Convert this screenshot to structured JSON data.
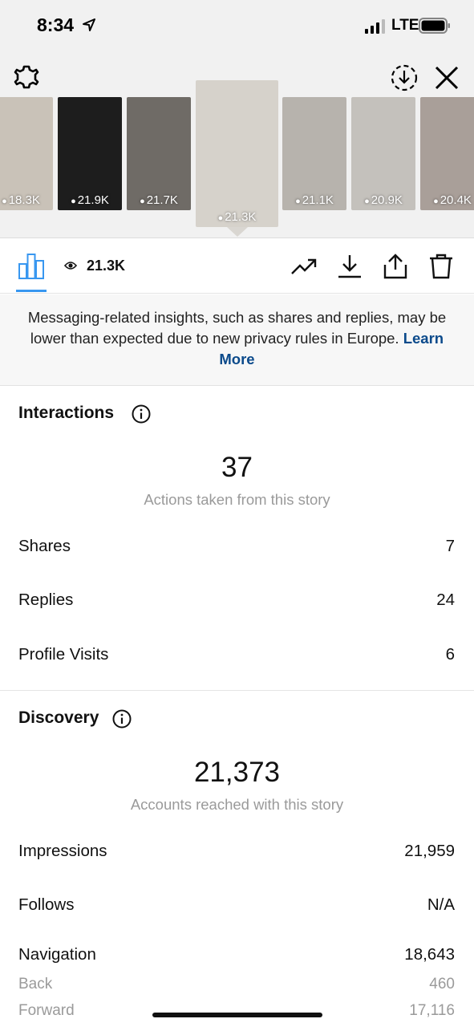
{
  "status_bar": {
    "time": "8:34",
    "network": "LTE"
  },
  "stories": [
    {
      "views": "18.3K",
      "bg": "#c9c2b8"
    },
    {
      "views": "21.9K",
      "bg": "#1d1d1d"
    },
    {
      "views": "21.7K",
      "bg": "#6f6b66"
    },
    {
      "views": "21.3K",
      "bg": "#d6d2cb",
      "selected": true
    },
    {
      "views": "21.1K",
      "bg": "#b7b3ad"
    },
    {
      "views": "20.9K",
      "bg": "#c4c1bc"
    },
    {
      "views": "20.4K",
      "bg": "#a99f99"
    }
  ],
  "toolbar": {
    "views": "21.3K",
    "accent": "#3897f0"
  },
  "notice": {
    "text": "Messaging-related insights, such as shares and replies, may be lower than expected due to new privacy rules in Europe.",
    "link": "Learn More"
  },
  "interactions": {
    "title": "Interactions",
    "total": "37",
    "caption": "Actions taken from this story",
    "rows": [
      {
        "label": "Shares",
        "value": "7"
      },
      {
        "label": "Replies",
        "value": "24"
      },
      {
        "label": "Profile Visits",
        "value": "6"
      }
    ]
  },
  "discovery": {
    "title": "Discovery",
    "total": "21,373",
    "caption": "Accounts reached with this story",
    "rows": [
      {
        "label": "Impressions",
        "value": "21,959"
      },
      {
        "label": "Follows",
        "value": "N/A"
      },
      {
        "label": "Navigation",
        "value": "18,643"
      }
    ],
    "sub_rows": [
      {
        "label": "Back",
        "value": "460"
      },
      {
        "label": "Forward",
        "value": "17,116"
      }
    ]
  }
}
